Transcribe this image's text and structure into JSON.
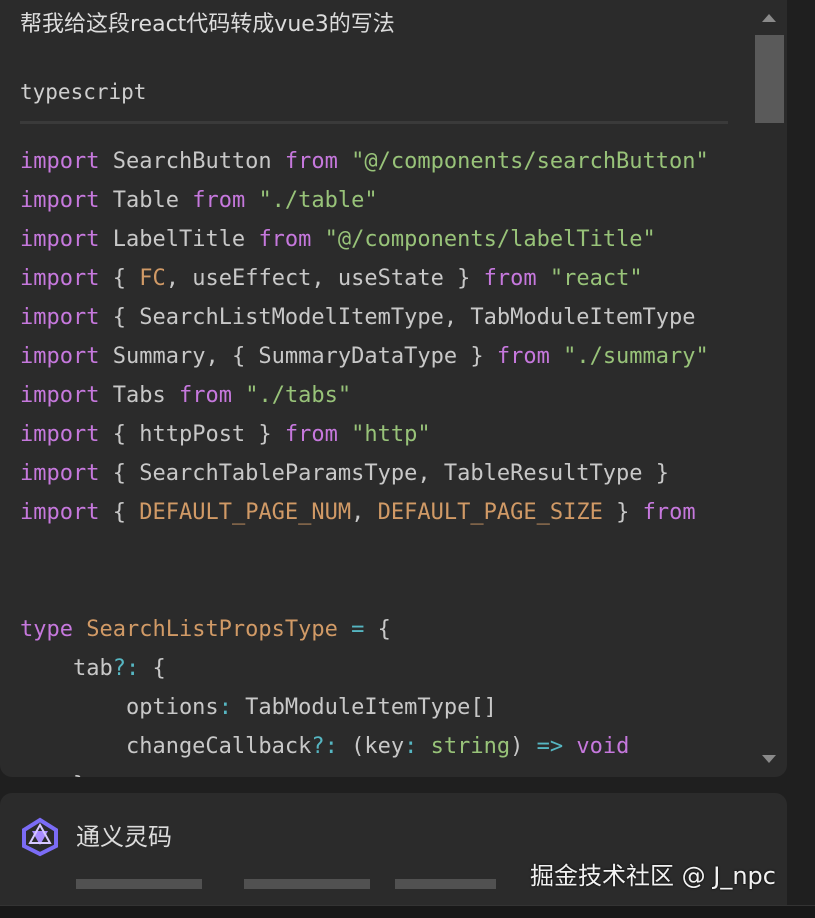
{
  "question": "帮我给这段react代码转成vue3的写法",
  "code_block": {
    "language": "typescript",
    "lines": [
      [
        {
          "t": "kw",
          "v": "import"
        },
        {
          "t": "id",
          "v": " SearchButton "
        },
        {
          "t": "kw",
          "v": "from"
        },
        {
          "t": "id",
          "v": " "
        },
        {
          "t": "str",
          "v": "\"@/components/searchButton\""
        }
      ],
      [
        {
          "t": "kw",
          "v": "import"
        },
        {
          "t": "id",
          "v": " Table "
        },
        {
          "t": "kw",
          "v": "from"
        },
        {
          "t": "id",
          "v": " "
        },
        {
          "t": "str",
          "v": "\"./table\""
        }
      ],
      [
        {
          "t": "kw",
          "v": "import"
        },
        {
          "t": "id",
          "v": " LabelTitle "
        },
        {
          "t": "kw",
          "v": "from"
        },
        {
          "t": "id",
          "v": " "
        },
        {
          "t": "str",
          "v": "\"@/components/labelTitle\""
        }
      ],
      [
        {
          "t": "kw",
          "v": "import"
        },
        {
          "t": "pun",
          "v": " { "
        },
        {
          "t": "type",
          "v": "FC"
        },
        {
          "t": "pun",
          "v": ", useEffect, useState } "
        },
        {
          "t": "kw",
          "v": "from"
        },
        {
          "t": "id",
          "v": " "
        },
        {
          "t": "str",
          "v": "\"react\""
        }
      ],
      [
        {
          "t": "kw",
          "v": "import"
        },
        {
          "t": "pun",
          "v": " { SearchListModelItemType, TabModuleItemType"
        }
      ],
      [
        {
          "t": "kw",
          "v": "import"
        },
        {
          "t": "id",
          "v": " Summary, "
        },
        {
          "t": "pun",
          "v": "{ SummaryDataType } "
        },
        {
          "t": "kw",
          "v": "from"
        },
        {
          "t": "id",
          "v": " "
        },
        {
          "t": "str",
          "v": "\"./summary\""
        }
      ],
      [
        {
          "t": "kw",
          "v": "import"
        },
        {
          "t": "id",
          "v": " Tabs "
        },
        {
          "t": "kw",
          "v": "from"
        },
        {
          "t": "id",
          "v": " "
        },
        {
          "t": "str",
          "v": "\"./tabs\""
        }
      ],
      [
        {
          "t": "kw",
          "v": "import"
        },
        {
          "t": "pun",
          "v": " { httpPost } "
        },
        {
          "t": "kw",
          "v": "from"
        },
        {
          "t": "id",
          "v": " "
        },
        {
          "t": "str",
          "v": "\"http\""
        }
      ],
      [
        {
          "t": "kw",
          "v": "import"
        },
        {
          "t": "pun",
          "v": " { SearchTableParamsType, TableResultType } "
        }
      ],
      [
        {
          "t": "kw",
          "v": "import"
        },
        {
          "t": "pun",
          "v": " { "
        },
        {
          "t": "type",
          "v": "DEFAULT_PAGE_NUM"
        },
        {
          "t": "pun",
          "v": ", "
        },
        {
          "t": "type",
          "v": "DEFAULT_PAGE_SIZE"
        },
        {
          "t": "pun",
          "v": " } "
        },
        {
          "t": "kw",
          "v": "from"
        }
      ],
      [],
      [],
      [
        {
          "t": "kw",
          "v": "type"
        },
        {
          "t": "id",
          "v": " "
        },
        {
          "t": "type",
          "v": "SearchListPropsType"
        },
        {
          "t": "id",
          "v": " "
        },
        {
          "t": "op",
          "v": "="
        },
        {
          "t": "pun",
          "v": " {"
        }
      ],
      [
        {
          "t": "id",
          "v": "    tab"
        },
        {
          "t": "op",
          "v": "?:"
        },
        {
          "t": "pun",
          "v": " {"
        }
      ],
      [
        {
          "t": "id",
          "v": "        options"
        },
        {
          "t": "op",
          "v": ":"
        },
        {
          "t": "id",
          "v": " TabModuleItemType[]"
        }
      ],
      [
        {
          "t": "id",
          "v": "        changeCallback"
        },
        {
          "t": "op",
          "v": "?:"
        },
        {
          "t": "pun",
          "v": " (key"
        },
        {
          "t": "op",
          "v": ":"
        },
        {
          "t": "id",
          "v": " "
        },
        {
          "t": "str",
          "v": "string"
        },
        {
          "t": "pun",
          "v": ") "
        },
        {
          "t": "op",
          "v": "=>"
        },
        {
          "t": "id",
          "v": " "
        },
        {
          "t": "kw",
          "v": "void"
        }
      ],
      [
        {
          "t": "pun",
          "v": "    }"
        }
      ]
    ]
  },
  "assistant": {
    "name": "通义灵码",
    "logo_icon": "tongyi-lingma-logo-icon"
  },
  "watermark": "掘金技术社区 @ J_npc"
}
